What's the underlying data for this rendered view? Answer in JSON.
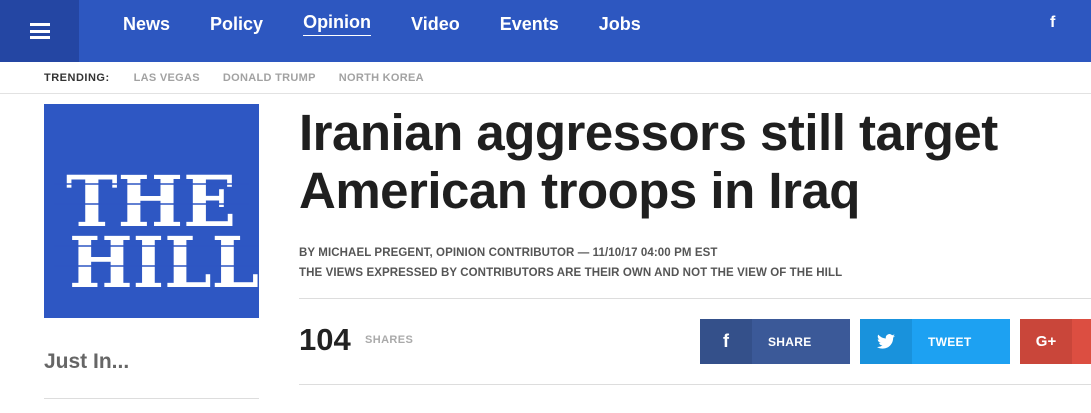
{
  "nav": {
    "items": [
      "News",
      "Policy",
      "Opinion",
      "Video",
      "Events",
      "Jobs"
    ],
    "active": "Opinion",
    "facebook_glyph": "f"
  },
  "trending": {
    "label": "TRENDING:",
    "items": [
      "LAS VEGAS",
      "DONALD TRUMP",
      "NORTH KOREA"
    ]
  },
  "logo": {
    "text_line1": "THE",
    "text_line2": "HILL",
    "color": "#2e57c3"
  },
  "sidebar": {
    "just_in": "Just In..."
  },
  "article": {
    "headline_line1": "Iranian aggressors still target",
    "headline_line2": "American troops in Iraq",
    "byline": "BY MICHAEL PREGENT, OPINION CONTRIBUTOR — 11/10/17 04:00 PM EST",
    "disclaimer": "THE VIEWS EXPRESSED BY CONTRIBUTORS ARE THEIR OWN AND NOT THE VIEW OF THE HILL"
  },
  "shares": {
    "count": "104",
    "label": "SHARES",
    "facebook": {
      "icon": "f",
      "label": "SHARE",
      "icon_name": "facebook-icon",
      "color": "#3b5998"
    },
    "twitter": {
      "icon": "🐦",
      "label": "TWEET",
      "icon_name": "twitter-bird-icon",
      "color": "#1da1f2"
    },
    "google": {
      "icon": "G+",
      "label": "",
      "icon_name": "google-plus-icon",
      "color": "#dc4e41"
    }
  }
}
